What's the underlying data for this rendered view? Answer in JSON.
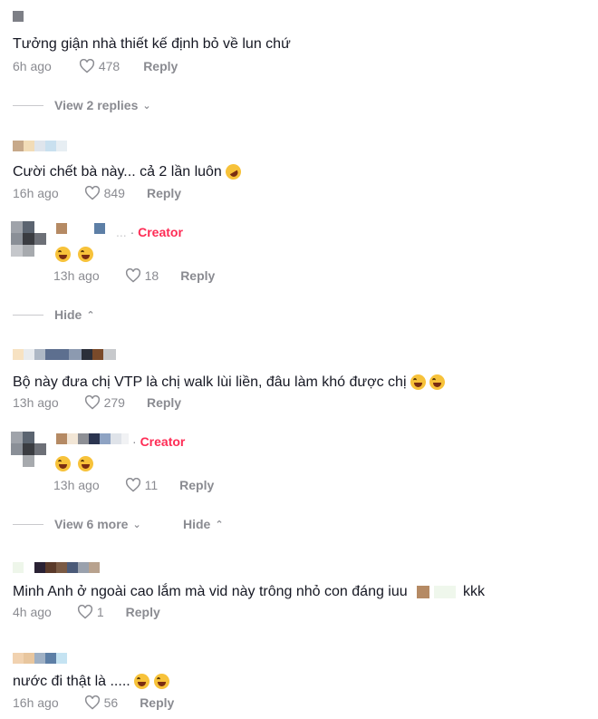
{
  "comments": [
    {
      "text": "Tưởng giận nhà thiết kế định bỏ về lun chứ",
      "time": "6h ago",
      "likes": "478",
      "reply": "Reply"
    },
    {
      "text": "Cười chết bà này... cả 2 lần luôn",
      "time": "16h ago",
      "likes": "849",
      "reply": "Reply"
    },
    {
      "text": "Bộ này đưa chị VTP là chị walk lùi liền, đâu làm khó được chị",
      "time": "13h ago",
      "likes": "279",
      "reply": "Reply"
    },
    {
      "text": "Minh Anh ở ngoài cao lắm mà vid này trông nhỏ con đáng iuu",
      "suffix": "kkk",
      "time": "4h ago",
      "likes": "1",
      "reply": "Reply"
    },
    {
      "text": "nước đi thật là .....",
      "time": "16h ago",
      "likes": "56",
      "reply": "Reply"
    }
  ],
  "replies": [
    {
      "tag": "Creator",
      "time": "13h ago",
      "likes": "18",
      "reply": "Reply"
    },
    {
      "tag": "Creator",
      "time": "13h ago",
      "likes": "11",
      "reply": "Reply"
    }
  ],
  "threads": {
    "view_replies": "View 2 replies",
    "hide_1": "Hide",
    "view_more": "View 6 more",
    "hide_2": "Hide"
  },
  "username_partial": "...",
  "colors": {
    "creator": "#fe2c55",
    "muted": "#8a8b91",
    "text": "#161823"
  }
}
